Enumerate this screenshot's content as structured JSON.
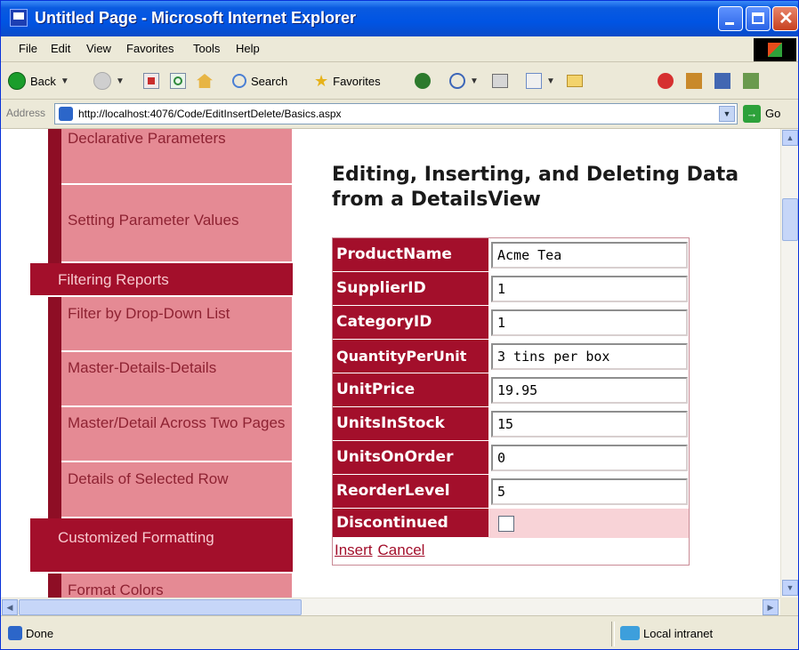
{
  "window": {
    "title": "Untitled Page - Microsoft Internet Explorer"
  },
  "menubar": {
    "items": [
      "File",
      "Edit",
      "View",
      "Favorites",
      "Tools",
      "Help"
    ]
  },
  "toolbar": {
    "back_label": "Back",
    "search_label": "Search",
    "favorites_label": "Favorites"
  },
  "address": {
    "label": "Address",
    "url": "http://localhost:4076/Code/EditInsertDelete/Basics.aspx",
    "go_label": "Go"
  },
  "sidebar": {
    "items": [
      {
        "label": "Declarative Parameters",
        "type": "sub"
      },
      {
        "label": "Setting Parameter Values",
        "type": "sub"
      },
      {
        "label": "Filtering Reports",
        "type": "header"
      },
      {
        "label": "Filter by Drop-Down List",
        "type": "sub"
      },
      {
        "label": "Master-Details-Details",
        "type": "sub"
      },
      {
        "label": "Master/Detail Across Two Pages",
        "type": "sub"
      },
      {
        "label": "Details of Selected Row",
        "type": "sub"
      },
      {
        "label": "Customized Formatting",
        "type": "header"
      },
      {
        "label": "Format Colors",
        "type": "sub"
      }
    ]
  },
  "page": {
    "title": "Editing, Inserting, and Deleting Data from a DetailsView"
  },
  "details_view": {
    "fields": [
      {
        "label": "ProductName",
        "value": "Acme Tea"
      },
      {
        "label": "SupplierID",
        "value": "1"
      },
      {
        "label": "CategoryID",
        "value": "1"
      },
      {
        "label": "QuantityPerUnit",
        "value": "3 tins per box"
      },
      {
        "label": "UnitPrice",
        "value": "19.95"
      },
      {
        "label": "UnitsInStock",
        "value": "15"
      },
      {
        "label": "UnitsOnOrder",
        "value": "0"
      },
      {
        "label": "ReorderLevel",
        "value": "5"
      }
    ],
    "discontinued_label": "Discontinued",
    "discontinued_checked": false,
    "insert_label": "Insert",
    "cancel_label": "Cancel"
  },
  "statusbar": {
    "status": "Done",
    "zone": "Local intranet"
  },
  "colors": {
    "accent": "#a30f2b",
    "nav_sub_bg": "#e58a94",
    "alt_row": "#f8d3d7"
  }
}
